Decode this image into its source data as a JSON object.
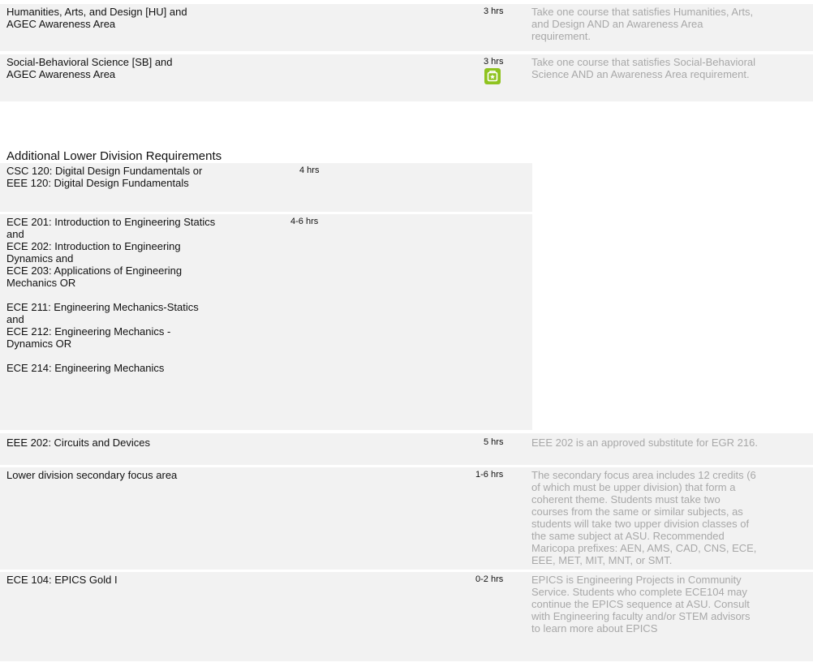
{
  "general_rows": [
    {
      "course": "Humanities, Arts, and Design [HU] and\nAGEC Awareness Area",
      "hours": "3 hrs",
      "note": "Take one course that satisfies Humanities, Arts,\nand Design AND an Awareness Area\nrequirement."
    },
    {
      "course": "Social-Behavioral Science [SB] and\nAGEC Awareness Area",
      "hours": "3 hrs",
      "note": "Take one course that satisfies Social-Behavioral\nScience AND an Awareness Area requirement.",
      "icon": "green-book-star-icon",
      "icon_color": "#8fc31f"
    }
  ],
  "section": {
    "title": "Additional Lower Division Requirements"
  },
  "additional_rows": [
    {
      "course": "CSC 120: Digital Design Fundamentals or\nEEE 120: Digital Design Fundamentals",
      "hours": "4 hrs",
      "note": ""
    },
    {
      "course": "ECE 201: Introduction to Engineering Statics\nand\nECE 202: Introduction to Engineering\nDynamics and\nECE 203: Applications of Engineering\nMechanics OR\n\nECE 211: Engineering Mechanics-Statics\nand\nECE 212: Engineering Mechanics -\nDynamics OR\n\nECE 214: Engineering Mechanics",
      "hours": "4-6 hrs",
      "note": ""
    },
    {
      "course": "EEE 202: Circuits and Devices",
      "hours": "5 hrs",
      "note": "EEE 202 is an approved substitute for EGR 216."
    },
    {
      "course": "Lower division secondary focus area",
      "hours": "1-6 hrs",
      "note": "The secondary focus area includes 12 credits (6\nof which must be upper division) that form a\ncoherent theme. Students must take two\ncourses from the same or similar subjects, as\nstudents will take two upper division classes of\nthe same subject at ASU. Recommended\nMaricopa prefixes: AEN, AMS, CAD, CNS, ECE,\nEEE, MET, MIT, MNT, or SMT."
    },
    {
      "course": "ECE 104: EPICS Gold I",
      "hours": "0-2 hrs",
      "note": "EPICS is Engineering Projects in Community\nService. Students who complete ECE104 may\ncontinue the EPICS sequence at ASU. Consult\nwith Engineering faculty and/or STEM advisors\nto learn more about EPICS"
    }
  ]
}
